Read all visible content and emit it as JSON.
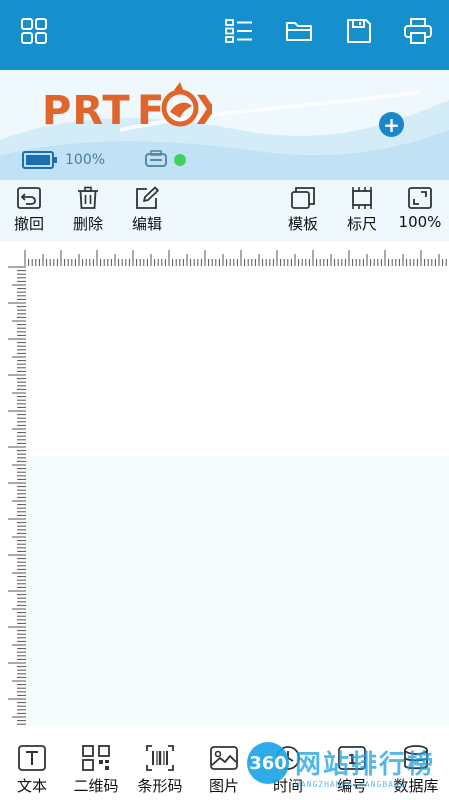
{
  "header": {
    "icons": [
      "grid-menu-icon",
      "list-icon",
      "folder-icon",
      "save-icon",
      "print-icon"
    ],
    "background": "#1590cd"
  },
  "banner": {
    "logo_text": "PRTFOX",
    "battery_text": "100%",
    "battery_level": 1.0,
    "connection": "connected",
    "status_color": "#3fd35a",
    "add_icon": "plus-icon"
  },
  "toolbar": {
    "undo_label": "撤回",
    "delete_label": "删除",
    "edit_label": "编辑",
    "template_label": "模板",
    "ruler_label": "标尺",
    "zoom_label": "100%"
  },
  "bottom_bar": {
    "items": [
      {
        "label": "文本",
        "icon": "text-icon"
      },
      {
        "label": "二维码",
        "icon": "qrcode-icon"
      },
      {
        "label": "条形码",
        "icon": "barcode-icon"
      },
      {
        "label": "图片",
        "icon": "image-icon"
      },
      {
        "label": "时间",
        "icon": "clock-icon"
      },
      {
        "label": "编号",
        "icon": "number-icon"
      },
      {
        "label": "数据库",
        "icon": "database-icon"
      }
    ]
  },
  "watermark": {
    "badge": "360",
    "text": "网站排行榜",
    "sub": "WANGZHANPAIHANGBANG"
  }
}
